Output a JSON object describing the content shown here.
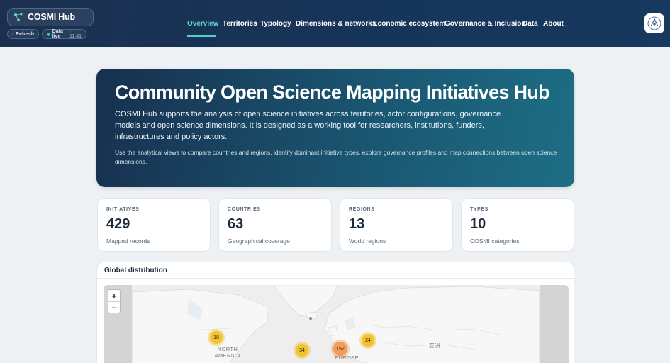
{
  "header": {
    "brand": "COSMI Hub",
    "refresh_label": "Refresh",
    "live_label": "Data live",
    "live_time": "· 11:41",
    "nav": [
      {
        "label": "Overview",
        "active": true
      },
      {
        "label": "Territories"
      },
      {
        "label": "Typology"
      },
      {
        "label": "Dimensions & networks"
      },
      {
        "label": "Economic ecosystem"
      },
      {
        "label": "Governance & Inclusion"
      },
      {
        "label": "Data"
      },
      {
        "label": "About"
      }
    ]
  },
  "hero": {
    "title": "Community Open Science Mapping Initiatives Hub",
    "lead": "COSMI Hub supports the analysis of open science initiatives across territories, actor configurations, governance models and open science dimensions. It is designed as a working tool for researchers, institutions, funders, infrastructures and policy actors.",
    "sub": "Use the analytical views to compare countries and regions, identify dominant initiative types, explore governance profiles and map connections between open science dimensions."
  },
  "stats": [
    {
      "label": "INITIATIVES",
      "value": "429",
      "caption": "Mapped records"
    },
    {
      "label": "COUNTRIES",
      "value": "63",
      "caption": "Geographical coverage"
    },
    {
      "label": "REGIONS",
      "value": "13",
      "caption": "World regions"
    },
    {
      "label": "TYPES",
      "value": "10",
      "caption": "COSMI categories"
    }
  ],
  "map": {
    "title": "Global distribution",
    "zoom_in": "+",
    "zoom_out": "−",
    "clusters": [
      "18",
      "34",
      "152",
      "24"
    ],
    "labels": {
      "north_america": "NORTH\nAMERICA",
      "europe": "EUROPE",
      "asia": "亚洲"
    }
  },
  "colors": {
    "header_bg": "#1b3050",
    "accent": "#4fd1c5",
    "cluster_yellow": "#f1c232",
    "cluster_orange": "#f39c5a"
  }
}
